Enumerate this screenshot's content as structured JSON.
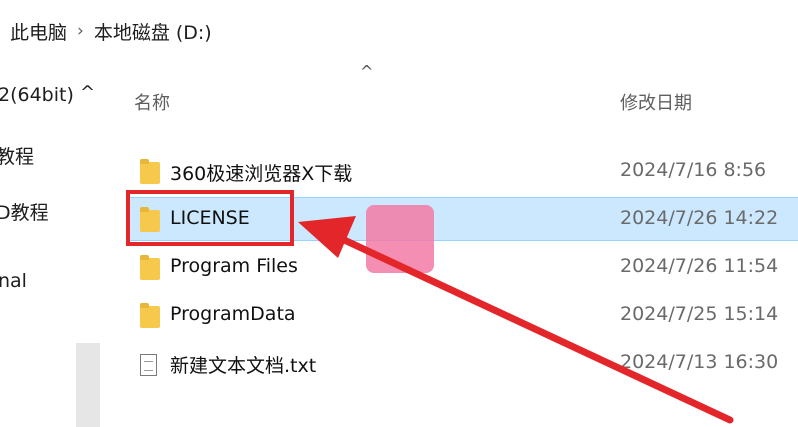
{
  "breadcrumb": {
    "this_pc": "此电脑",
    "separator": "›",
    "drive": "本地磁盘 (D:)"
  },
  "nav_pane": {
    "items": [
      "2(64bit)",
      "教程",
      "D教程",
      "nal"
    ]
  },
  "columns": {
    "name": "名称",
    "modified": "修改日期"
  },
  "files": [
    {
      "name": "360极速浏览器X下载",
      "date": "2024/7/16 8:56",
      "type": "folder"
    },
    {
      "name": "LICENSE",
      "date": "2024/7/26 14:22",
      "type": "folder",
      "selected": true
    },
    {
      "name": "Program Files",
      "date": "2024/7/26 11:54",
      "type": "folder"
    },
    {
      "name": "ProgramData",
      "date": "2024/7/25 15:14",
      "type": "folder"
    },
    {
      "name": "新建文本文档.txt",
      "date": "2024/7/13 16:30",
      "type": "text-file"
    }
  ],
  "colors": {
    "selection": "#cce8ff",
    "annotation": "#e3262a",
    "folder": "#f6c84c"
  }
}
